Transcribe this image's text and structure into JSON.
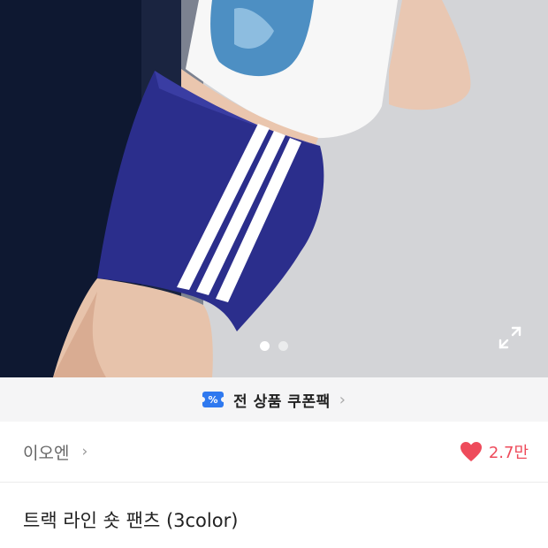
{
  "gallery": {
    "image_alt": "product photo",
    "page_index": 1,
    "page_count": 2,
    "expand_icon": "expand-icon"
  },
  "coupon": {
    "icon": "coupon-icon",
    "icon_glyph": "%",
    "label": "전 상품 쿠폰팩",
    "chevron": "›"
  },
  "store": {
    "name": "이오엔",
    "chevron": "›"
  },
  "likes": {
    "icon": "heart-icon",
    "count": "2.7만",
    "color": "#ee4b5b"
  },
  "product": {
    "title": "트랙 라인 숏 팬츠 (3color)"
  },
  "colors": {
    "coupon_icon": "#2f79ef",
    "shorts": "#2b2e8c",
    "heart": "#ee4b5b"
  }
}
